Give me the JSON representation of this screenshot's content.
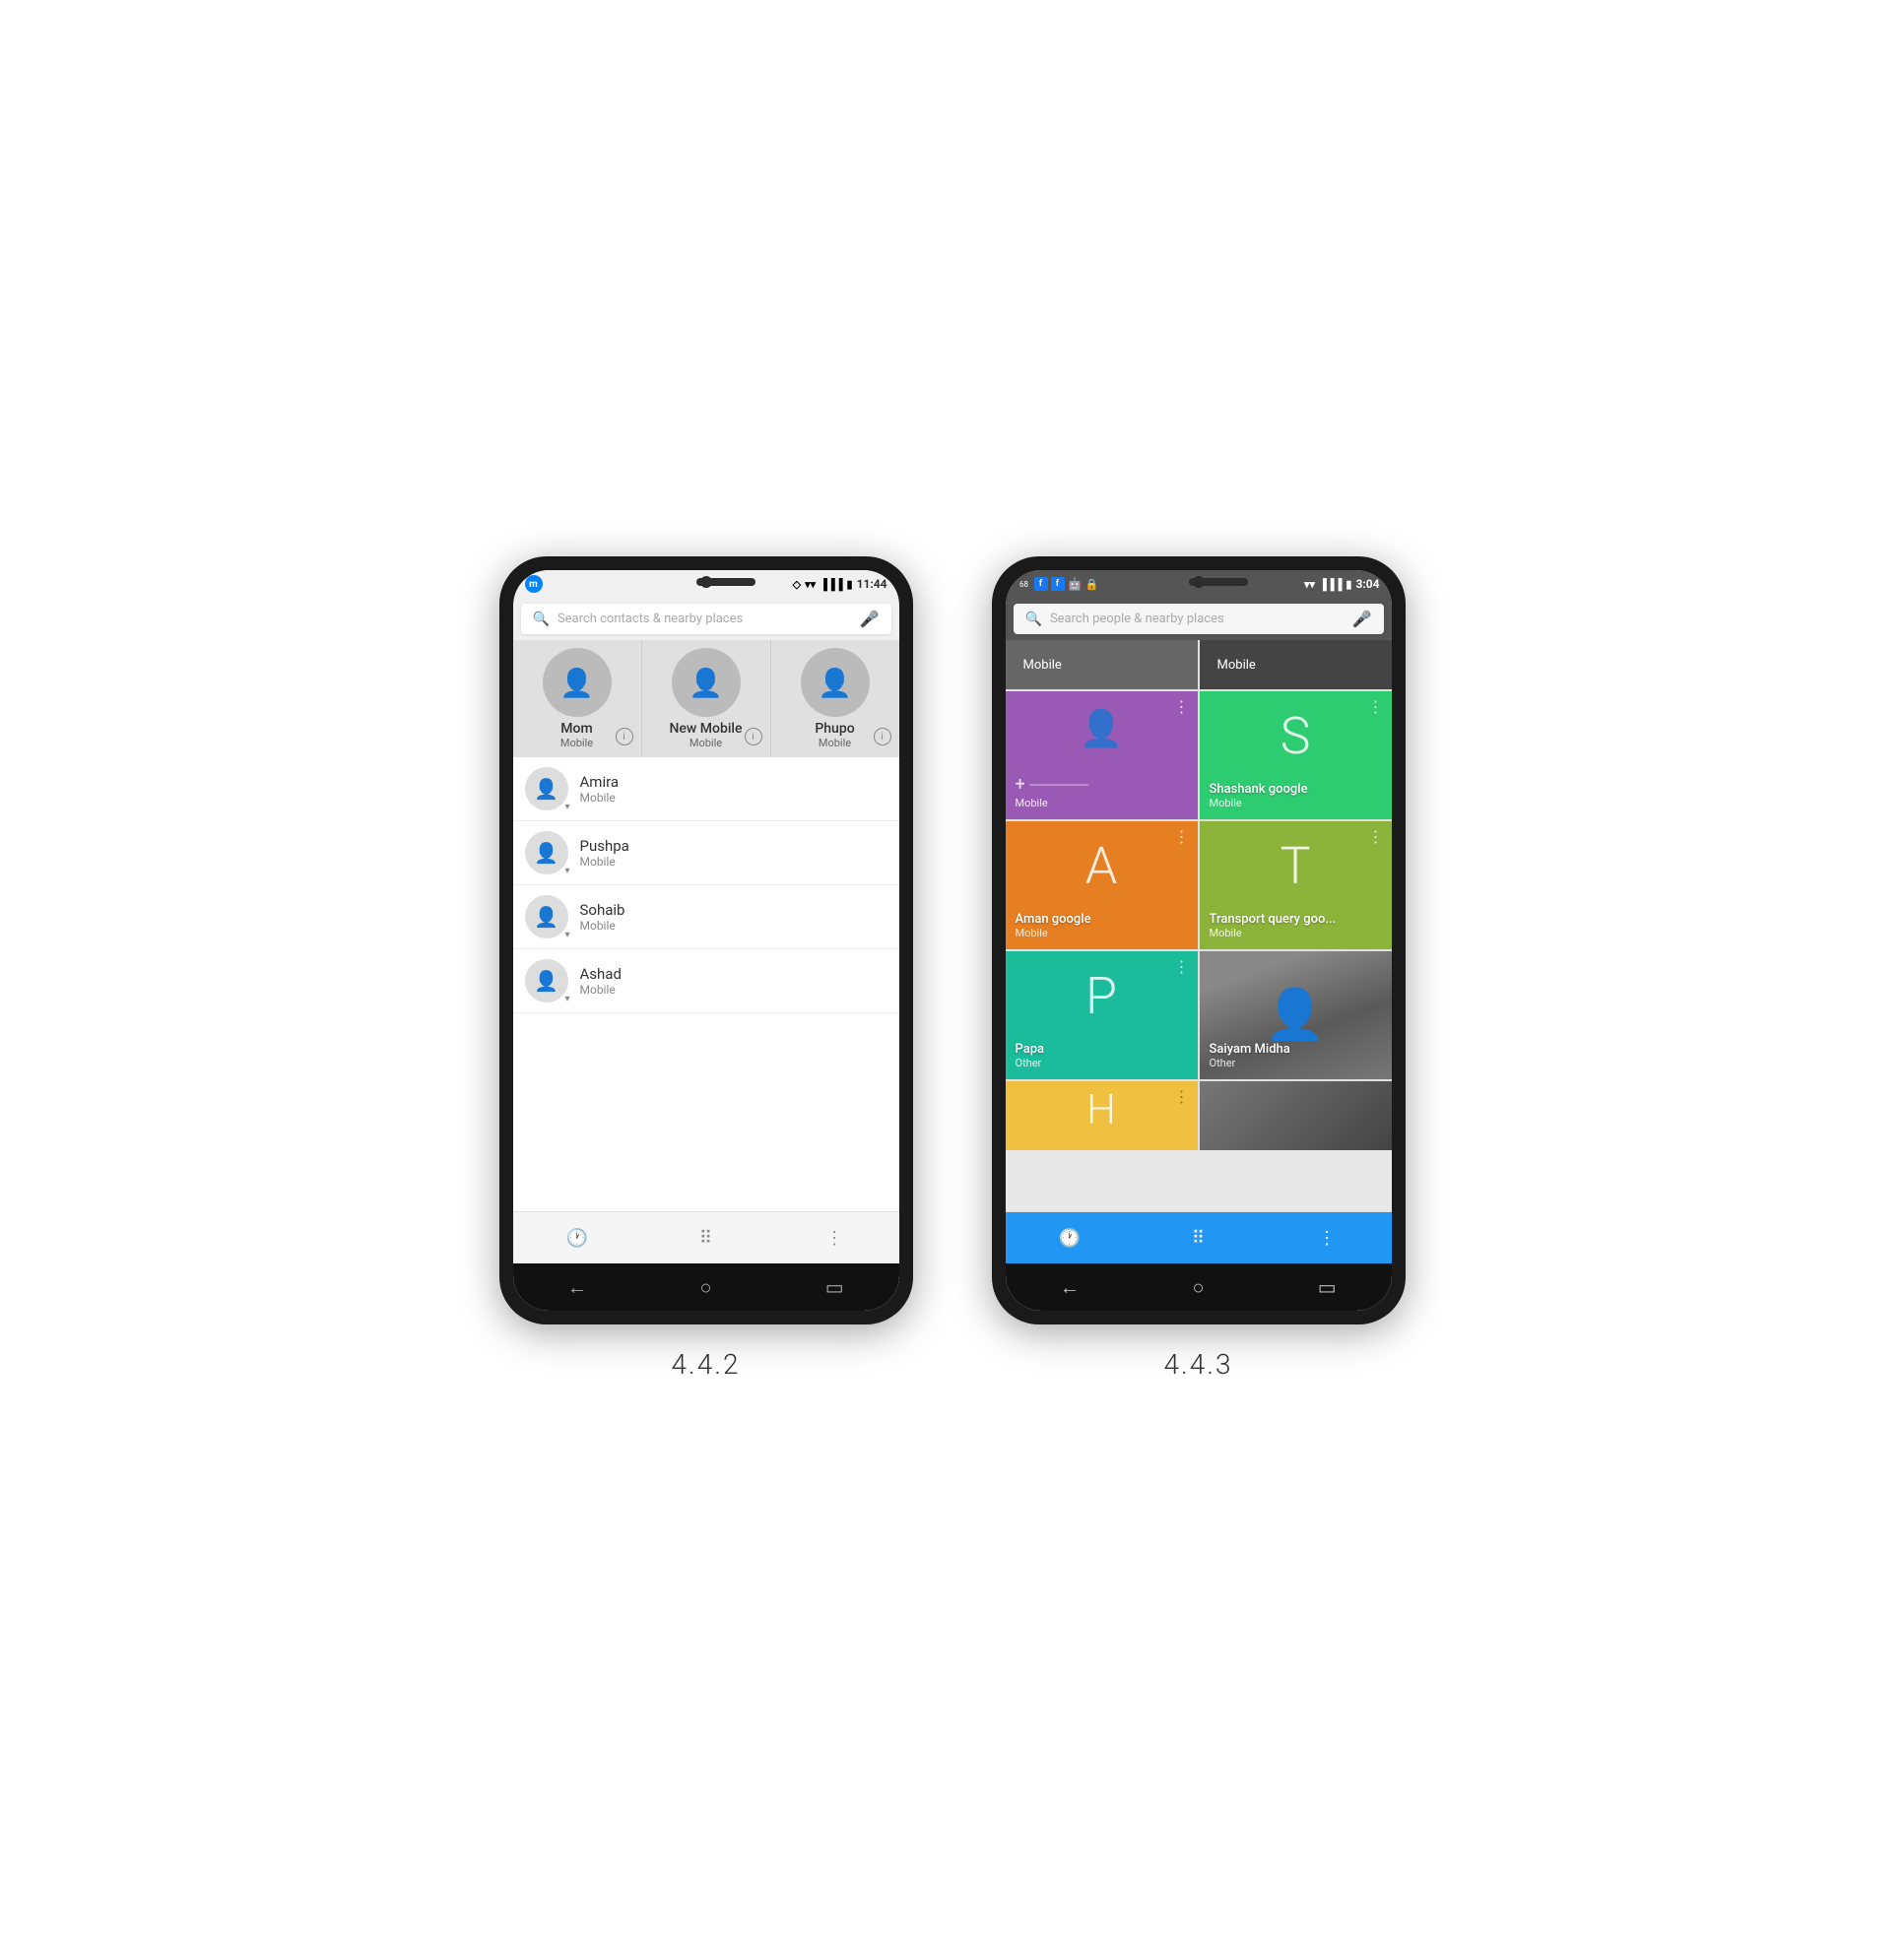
{
  "phones": {
    "old": {
      "version": "4.4.2",
      "statusBar": {
        "time": "11:44",
        "leftIcons": [
          "messenger"
        ],
        "rightIcons": [
          "diamond",
          "wifi",
          "signal",
          "battery"
        ]
      },
      "search": {
        "placeholder": "Search contacts & nearby places"
      },
      "favorites": [
        {
          "name": "Mom",
          "type": "Mobile"
        },
        {
          "name": "New Mobile",
          "type": "Mobile"
        },
        {
          "name": "Phupo",
          "type": "Mobile"
        }
      ],
      "contacts": [
        {
          "name": "Amira",
          "type": "Mobile"
        },
        {
          "name": "Pushpa",
          "type": "Mobile"
        },
        {
          "name": "Sohaib",
          "type": "Mobile"
        },
        {
          "name": "Ashad",
          "type": "Mobile"
        }
      ],
      "bottomNav": {
        "icons": [
          "clock",
          "dialpad",
          "more"
        ]
      }
    },
    "new": {
      "version": "4.4.3",
      "statusBar": {
        "time": "3:04",
        "leftIcons": [
          "circle-68",
          "fb",
          "fb",
          "android",
          "lock"
        ],
        "rightIcons": [
          "wifi",
          "signal",
          "battery"
        ]
      },
      "search": {
        "placeholder": "Search people & nearby places"
      },
      "gridCards": [
        {
          "letter": "+",
          "name": "",
          "type": "Mobile",
          "color": "purple",
          "partial": true
        },
        {
          "letter": "Mobile",
          "name": "",
          "type": "",
          "color": "dark",
          "partial": true
        },
        {
          "letter": "+",
          "name": "",
          "type": "Mobile",
          "color": "purple",
          "isNew": true
        },
        {
          "letter": "S",
          "name": "Shashank google",
          "type": "Mobile",
          "color": "green"
        },
        {
          "letter": "A",
          "name": "Aman google",
          "type": "Mobile",
          "color": "orange"
        },
        {
          "letter": "T",
          "name": "Transport query goo...",
          "type": "Mobile",
          "color": "olive"
        },
        {
          "letter": "P",
          "name": "Papa",
          "type": "Other",
          "color": "teal"
        },
        {
          "letter": "photo",
          "name": "Saiyam Midha",
          "type": "Other",
          "color": "photo"
        },
        {
          "letter": "H",
          "name": "",
          "type": "",
          "color": "yellow",
          "partial": true
        },
        {
          "letter": "photo2",
          "name": "",
          "type": "",
          "color": "photo2",
          "partial": true
        }
      ],
      "bottomNav": {
        "icons": [
          "clock",
          "dialpad",
          "more"
        ],
        "color": "blue"
      }
    }
  }
}
